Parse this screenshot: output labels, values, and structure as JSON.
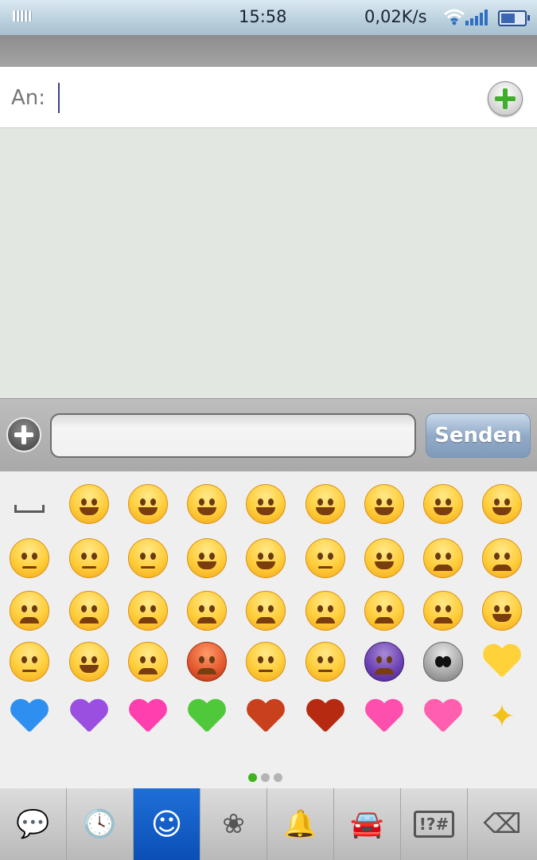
{
  "status_bar": {
    "time": "15:58",
    "net_speed": "0,02K/s",
    "icons": [
      "keyboard-icon",
      "wifi-icon",
      "signal-icon",
      "battery-icon"
    ]
  },
  "recipient": {
    "label": "An:",
    "value": ""
  },
  "compose": {
    "input_value": "",
    "send_label": "Senden"
  },
  "emoji_grid": {
    "rows": [
      [
        "space",
        "grin",
        "smile",
        "smiley",
        "relaxed",
        "wink",
        "heart-eyes",
        "kissing-heart",
        "kissing-closed-eyes"
      ],
      [
        "flushed",
        "relieved",
        "grimacing",
        "stuck-out-tongue-winking",
        "stuck-out-tongue-closed-eyes",
        "unamused",
        "smirk",
        "sweat",
        "pensive"
      ],
      [
        "disappointed",
        "confounded",
        "disappointed-relieved",
        "cold-sweat",
        "fearful",
        "persevere",
        "cry",
        "sob",
        "joy"
      ],
      [
        "astonished",
        "scream",
        "angry",
        "rage",
        "sleepy",
        "mask",
        "imp",
        "alien",
        "yellow-heart"
      ],
      [
        "blue-heart",
        "purple-heart",
        "heartpulse",
        "green-heart",
        "heart",
        "broken-heart",
        "sparkling-heart",
        "cupid",
        "sparkles"
      ]
    ],
    "page": 1,
    "page_count": 3
  },
  "categories": [
    {
      "name": "recent-messages",
      "icon": "speech-bubble-icon",
      "glyph": "💬"
    },
    {
      "name": "recent",
      "icon": "clock-icon",
      "glyph": "🕓"
    },
    {
      "name": "people",
      "icon": "smiley-icon",
      "glyph": "☺",
      "active": true
    },
    {
      "name": "nature",
      "icon": "flower-icon",
      "glyph": "❀"
    },
    {
      "name": "objects",
      "icon": "bell-icon",
      "glyph": "🔔"
    },
    {
      "name": "places",
      "icon": "car-icon",
      "glyph": "🚘"
    },
    {
      "name": "symbols",
      "icon": "symbols-icon",
      "glyph": "!?#"
    },
    {
      "name": "delete",
      "icon": "backspace-icon",
      "glyph": "⌫"
    }
  ],
  "colors": {
    "accent_blue": "#0b4fb6",
    "send_button": "#93abc8",
    "message_area": "#e2e8e1",
    "page_dot_active": "#3fb21f"
  }
}
